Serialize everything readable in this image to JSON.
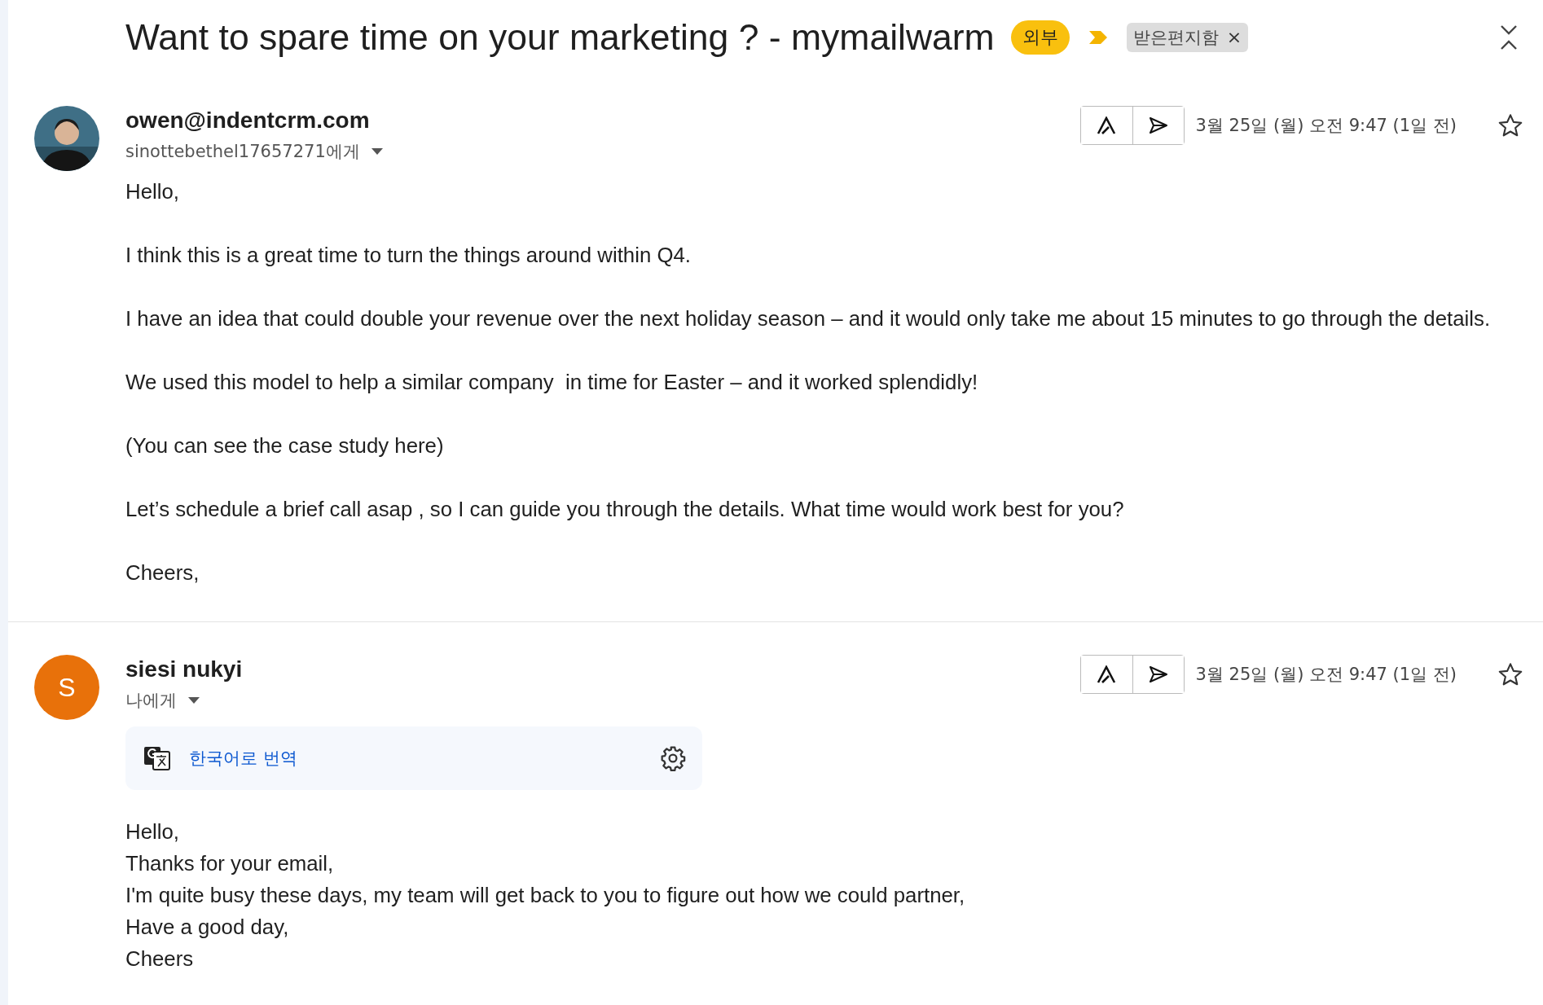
{
  "subject": {
    "title": "Want to spare time on your marketing ? - mymailwarm",
    "badge": "외부",
    "important": true,
    "label": {
      "text": "받은편지함",
      "remove": "×"
    }
  },
  "messages": [
    {
      "sender": "owen@indentcrm.com",
      "avatar": {
        "kind": "photo"
      },
      "recipient": "sinottebethel17657271에게",
      "date": "3월 25일 (월) 오전 9:47 (1일 전)",
      "starred": false,
      "kind": "paragraphs",
      "body": [
        "Hello,",
        "I think this is a great time to turn the things around within Q4.",
        "I have an idea that could double your revenue over the next holiday season – and it would only take me about 15 minutes to go through the details.",
        "We used this model to help a similar company  in time for Easter – and it worked splendidly!",
        "(You can see the case study here)",
        "Let’s schedule a brief call asap , so I can guide you through the details. What time would work best for you?",
        "Cheers,"
      ]
    },
    {
      "sender": "siesi nukyi",
      "avatar": {
        "kind": "initial",
        "initial": "S",
        "color": "#e8710a"
      },
      "recipient": "나에게",
      "date": "3월 25일 (월) 오전 9:47 (1일 전)",
      "starred": false,
      "translate": {
        "label": "한국어로 번역"
      },
      "kind": "lines",
      "body": [
        "Hello,",
        "Thanks for your email,",
        "I'm quite busy these days, my team will get back to you to figure out how we could partner,",
        "Have a good day,",
        "Cheers"
      ]
    }
  ]
}
